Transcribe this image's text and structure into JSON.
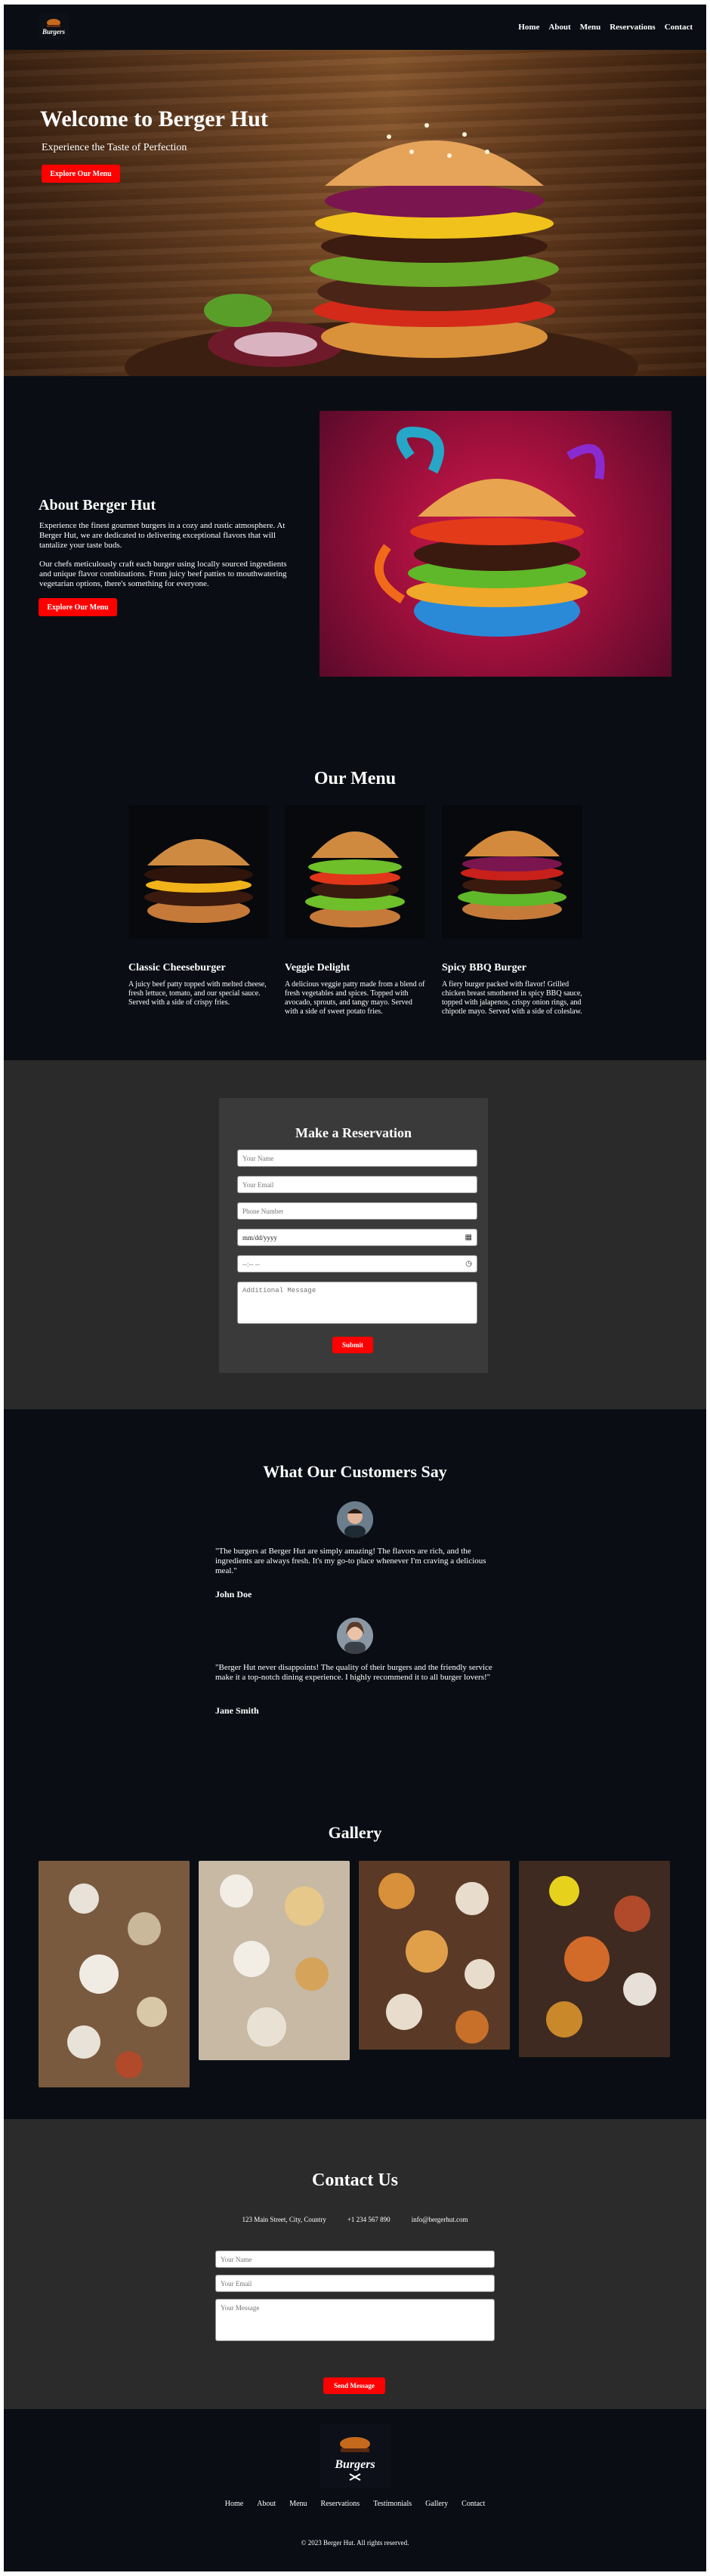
{
  "brand": {
    "logo_text": "Burgers",
    "accent": "#ff0000"
  },
  "nav": {
    "items": [
      "Home",
      "About",
      "Menu",
      "Reservations",
      "Contact"
    ]
  },
  "hero": {
    "title": "Welcome to Berger Hut",
    "subtitle": "Experience the Taste of Perfection",
    "button": "Explore Our Menu"
  },
  "about": {
    "title": "About Berger Hut",
    "para1": "Experience the finest gourmet burgers in a cozy and rustic atmosphere. At Berger Hut, we are dedicated to delivering exceptional flavors that will tantalize your taste buds.",
    "para2": "Our chefs meticulously craft each burger using locally sourced ingredients and unique flavor combinations. From juicy beef patties to mouthwatering vegetarian options, there's something for everyone.",
    "button": "Explore Our Menu"
  },
  "menu": {
    "title": "Our Menu",
    "items": [
      {
        "name": "Classic Cheeseburger",
        "desc": "A juicy beef patty topped with melted cheese, fresh lettuce, tomato, and our special sauce. Served with a side of crispy fries."
      },
      {
        "name": "Veggie Delight",
        "desc": "A delicious veggie patty made from a blend of fresh vegetables and spices. Topped with avocado, sprouts, and tangy mayo. Served with a side of sweet potato fries."
      },
      {
        "name": "Spicy BBQ Burger",
        "desc": "A fiery burger packed with flavor! Grilled chicken breast smothered in spicy BBQ sauce, topped with jalapenos, crispy onion rings, and chipotle mayo. Served with a side of coleslaw."
      }
    ]
  },
  "reservation": {
    "title": "Make a Reservation",
    "name_placeholder": "Your Name",
    "email_placeholder": "Your Email",
    "phone_placeholder": "Phone Number",
    "date_placeholder": "mm/dd/yyyy",
    "time_placeholder": "--:-- --",
    "message_placeholder": "Additional Message",
    "button": "Submit"
  },
  "testimonials": {
    "title": "What Our Customers Say",
    "items": [
      {
        "quote": "\"The burgers at Berger Hut are simply amazing! The flavors are rich, and the ingredients are always fresh. It's my go-to place whenever I'm craving a delicious meal.\"",
        "name": "John Doe"
      },
      {
        "quote": "\"Berger Hut never disappoints! The quality of their burgers and the friendly service make it a top-notch dining experience. I highly recommend it to all burger lovers!\"",
        "name": "Jane Smith"
      }
    ]
  },
  "gallery": {
    "title": "Gallery"
  },
  "contact": {
    "title": "Contact Us",
    "address": "123 Main Street, City, Country",
    "phone": "+1 234 567 890",
    "email": "info@bergerhut.com",
    "name_placeholder": "Your Name",
    "email_placeholder": "Your Email",
    "message_placeholder": "Your Message",
    "button": "Send Message"
  },
  "footer": {
    "nav": [
      "Home",
      "About",
      "Menu",
      "Reservations",
      "Testimonials",
      "Gallery",
      "Contact"
    ],
    "copyright": "© 2023 Berger Hut. All rights reserved."
  }
}
